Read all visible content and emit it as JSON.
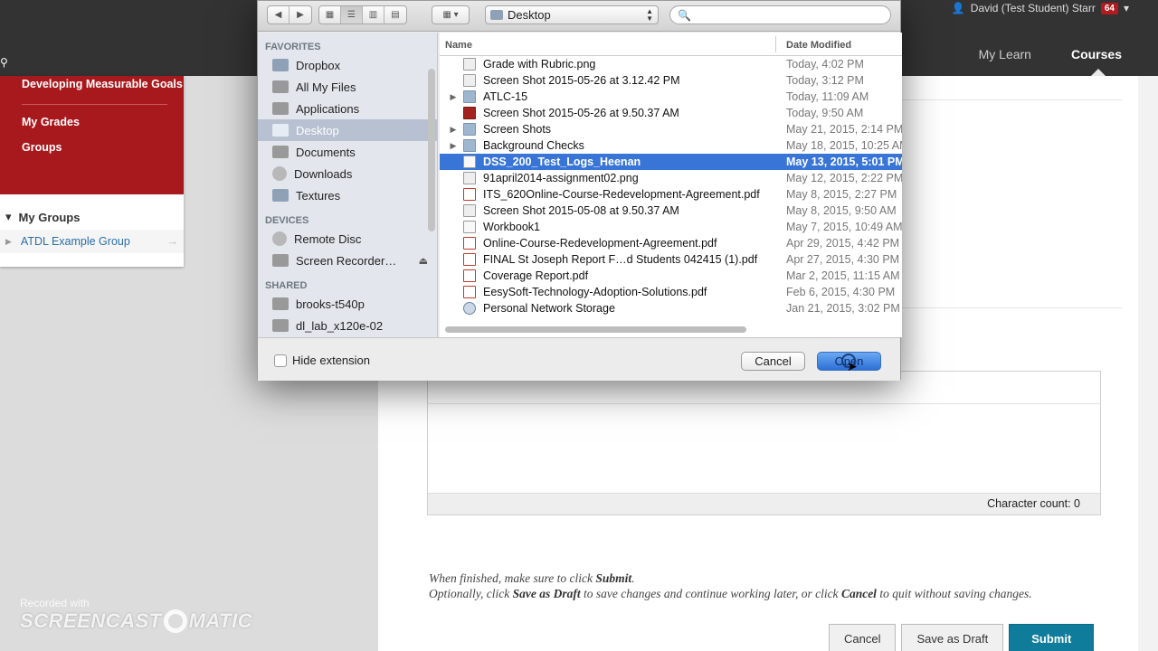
{
  "topbar": {
    "user_name": "David (Test Student) Starr",
    "notification_count": "64",
    "nav": [
      "My Learn",
      "Courses"
    ]
  },
  "left_panel": {
    "goal_item": "Developing Measurable Goals",
    "links": [
      "My Grades",
      "Groups"
    ],
    "my_groups_label": "My Groups",
    "group_item": "ATDL Example Group"
  },
  "editor": {
    "char_count": "Character count: 0"
  },
  "instructions": {
    "line1_prefix": "When finished, make sure to click ",
    "line1_bold": "Submit",
    "line1_suffix": ".",
    "line2_prefix": "Optionally, click ",
    "line2_bold1": "Save as Draft",
    "line2_mid": " to save changes and continue working later, or click ",
    "line2_bold2": "Cancel",
    "line2_suffix": " to quit without saving changes."
  },
  "page_buttons": {
    "cancel": "Cancel",
    "save_draft": "Save as Draft",
    "submit": "Submit"
  },
  "watermark": {
    "small": "Recorded with",
    "brand_left": "SCREENCAST",
    "brand_right": "MATIC"
  },
  "dialog": {
    "location": "Desktop",
    "search_placeholder": "",
    "sidebar": {
      "favorites_header": "FAVORITES",
      "favorites": [
        {
          "label": "Dropbox",
          "icon": "folder-icon"
        },
        {
          "label": "All My Files",
          "icon": "all-files-icon"
        },
        {
          "label": "Applications",
          "icon": "applications-icon"
        },
        {
          "label": "Desktop",
          "icon": "desktop-icon",
          "selected": true
        },
        {
          "label": "Documents",
          "icon": "documents-icon"
        },
        {
          "label": "Downloads",
          "icon": "downloads-icon"
        },
        {
          "label": "Textures",
          "icon": "folder-icon"
        }
      ],
      "devices_header": "DEVICES",
      "devices": [
        {
          "label": "Remote Disc",
          "icon": "disc-icon"
        },
        {
          "label": "Screen Recorder…",
          "icon": "drive-icon"
        }
      ],
      "shared_header": "SHARED",
      "shared": [
        {
          "label": "brooks-t540p",
          "icon": "computer-icon"
        },
        {
          "label": "dl_lab_x120e-02",
          "icon": "computer-icon"
        }
      ]
    },
    "columns": {
      "name": "Name",
      "date": "Date Modified"
    },
    "files": [
      {
        "name": "Grade with Rubric.png",
        "date": "Today, 4:02 PM",
        "type": "img"
      },
      {
        "name": "Screen Shot 2015-05-26 at 3.12.42 PM",
        "date": "Today, 3:12 PM",
        "type": "img"
      },
      {
        "name": "ATLC-15",
        "date": "Today, 11:09 AM",
        "type": "folder"
      },
      {
        "name": "Screen Shot 2015-05-26 at 9.50.37 AM",
        "date": "Today, 9:50 AM",
        "type": "red"
      },
      {
        "name": "Screen Shots",
        "date": "May 21, 2015, 2:14 PM",
        "type": "folder"
      },
      {
        "name": "Background Checks",
        "date": "May 18, 2015, 10:25 AM",
        "type": "folder"
      },
      {
        "name": "DSS_200_Test_Logs_Heenan",
        "date": "May 13, 2015, 5:01 PM",
        "type": "doc",
        "selected": true
      },
      {
        "name": "91april2014-assignment02.png",
        "date": "May 12, 2015, 2:22 PM",
        "type": "img"
      },
      {
        "name": "ITS_620Online-Course-Redevelopment-Agreement.pdf",
        "date": "May 8, 2015, 2:27 PM",
        "type": "pdf"
      },
      {
        "name": "Screen Shot 2015-05-08 at 9.50.37 AM",
        "date": "May 8, 2015, 9:50 AM",
        "type": "img"
      },
      {
        "name": "Workbook1",
        "date": "May 7, 2015, 10:49 AM",
        "type": "doc"
      },
      {
        "name": "Online-Course-Redevelopment-Agreement.pdf",
        "date": "Apr 29, 2015, 4:42 PM",
        "type": "pdf"
      },
      {
        "name": "FINAL St Joseph Report F…d Students 042415 (1).pdf",
        "date": "Apr 27, 2015, 4:30 PM",
        "type": "pdf"
      },
      {
        "name": "Coverage Report.pdf",
        "date": "Mar 2, 2015, 11:15 AM",
        "type": "pdf"
      },
      {
        "name": "EesySoft-Technology-Adoption-Solutions.pdf",
        "date": "Feb 6, 2015, 4:30 PM",
        "type": "pdf"
      },
      {
        "name": "Personal Network Storage",
        "date": "Jan 21, 2015, 3:02 PM",
        "type": "net"
      }
    ],
    "hide_extension_label": "Hide extension",
    "cancel_label": "Cancel",
    "open_label": "Open"
  }
}
